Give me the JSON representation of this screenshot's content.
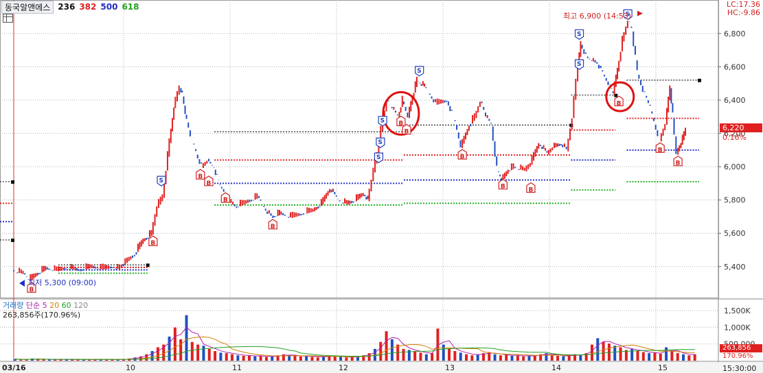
{
  "header": {
    "stock_name": "동국알앤에스",
    "periods": [
      "236",
      "382",
      "500",
      "618"
    ]
  },
  "top_right": {
    "lc": "LC:17.36",
    "hc": "HC:-9.86"
  },
  "labels": {
    "high": "최고 6,900 (14:53)",
    "low": "최저 5,300 (09:00)",
    "current_price": "6,220",
    "current_pct": "0.16%",
    "volume_value": "263,856",
    "volume_pct": "170.96%",
    "time": "15:30:00"
  },
  "volume_legend": {
    "title": "거래량",
    "ma_label": "단순 5",
    "p20": "20",
    "p60": "60",
    "p120": "120",
    "value_line": "263,856주(170.96%)"
  },
  "colors": {
    "up": "#e02020",
    "down": "#2050c0",
    "grid": "#b0b0b0",
    "ma5": "#b020b0",
    "ma20": "#d08000",
    "ma60": "#20a020",
    "fib_red": "#e02020",
    "fib_blue": "#2030c0",
    "fib_green": "#20b020",
    "fib_black": "#222222"
  },
  "chart_data": {
    "type": "line",
    "price_axis": {
      "min": 5300,
      "max": 6900,
      "ticks": [
        5400,
        5600,
        5800,
        6000,
        6200,
        6400,
        6600,
        6800
      ],
      "tick_labels": [
        "5,400",
        "5,600",
        "5,800",
        "6,000",
        "6,200",
        "6,400",
        "6,600",
        "6,800"
      ]
    },
    "volume_axis": {
      "ticks": [
        1500000,
        1000000,
        500000
      ],
      "tick_labels": [
        "1,500K",
        "1,000K",
        "500,000"
      ]
    },
    "x_labels": [
      "03/16",
      "10",
      "11",
      "12",
      "13",
      "14",
      "15"
    ],
    "price_path": [
      {
        "t": 0.0,
        "p": 5380
      },
      {
        "t": 0.2,
        "p": 5360
      },
      {
        "t": 0.3,
        "p": 5320
      },
      {
        "t": 0.45,
        "p": 5360
      },
      {
        "t": 0.6,
        "p": 5390
      },
      {
        "t": 0.8,
        "p": 5380
      },
      {
        "t": 1.0,
        "p": 5395
      },
      {
        "t": 1.2,
        "p": 5380
      },
      {
        "t": 1.4,
        "p": 5400
      },
      {
        "t": 1.6,
        "p": 5390
      },
      {
        "t": 1.8,
        "p": 5400
      },
      {
        "t": 1.9,
        "p": 5390
      },
      {
        "t": 2.0,
        "p": 5420
      },
      {
        "t": 2.2,
        "p": 5480
      },
      {
        "t": 2.35,
        "p": 5560
      },
      {
        "t": 2.5,
        "p": 5600
      },
      {
        "t": 2.6,
        "p": 5760
      },
      {
        "t": 2.7,
        "p": 5820
      },
      {
        "t": 2.82,
        "p": 6150
      },
      {
        "t": 2.9,
        "p": 6360
      },
      {
        "t": 3.0,
        "p": 6480
      },
      {
        "t": 3.05,
        "p": 6430
      },
      {
        "t": 3.1,
        "p": 6320
      },
      {
        "t": 3.2,
        "p": 6180
      },
      {
        "t": 3.3,
        "p": 6080
      },
      {
        "t": 3.4,
        "p": 6000
      },
      {
        "t": 3.5,
        "p": 6040
      },
      {
        "t": 3.62,
        "p": 5990
      },
      {
        "t": 3.7,
        "p": 5900
      },
      {
        "t": 3.8,
        "p": 5860
      },
      {
        "t": 3.9,
        "p": 5790
      },
      {
        "t": 4.0,
        "p": 5760
      },
      {
        "t": 4.2,
        "p": 5790
      },
      {
        "t": 4.4,
        "p": 5820
      },
      {
        "t": 4.55,
        "p": 5740
      },
      {
        "t": 4.65,
        "p": 5700
      },
      {
        "t": 4.8,
        "p": 5720
      },
      {
        "t": 5.0,
        "p": 5700
      },
      {
        "t": 5.2,
        "p": 5720
      },
      {
        "t": 5.4,
        "p": 5740
      },
      {
        "t": 5.55,
        "p": 5780
      },
      {
        "t": 5.7,
        "p": 5870
      },
      {
        "t": 5.85,
        "p": 5800
      },
      {
        "t": 6.0,
        "p": 5780
      },
      {
        "t": 6.15,
        "p": 5800
      },
      {
        "t": 6.3,
        "p": 5840
      },
      {
        "t": 6.38,
        "p": 5800
      },
      {
        "t": 6.45,
        "p": 5920
      },
      {
        "t": 6.55,
        "p": 6080
      },
      {
        "t": 6.62,
        "p": 6220
      },
      {
        "t": 6.72,
        "p": 6400
      },
      {
        "t": 6.82,
        "p": 6350
      },
      {
        "t": 6.92,
        "p": 6300
      },
      {
        "t": 7.0,
        "p": 6400
      },
      {
        "t": 7.1,
        "p": 6300
      },
      {
        "t": 7.18,
        "p": 6420
      },
      {
        "t": 7.26,
        "p": 6520
      },
      {
        "t": 7.4,
        "p": 6480
      },
      {
        "t": 7.6,
        "p": 6380
      },
      {
        "t": 7.8,
        "p": 6400
      },
      {
        "t": 7.95,
        "p": 6260
      },
      {
        "t": 8.05,
        "p": 6120
      },
      {
        "t": 8.2,
        "p": 6250
      },
      {
        "t": 8.3,
        "p": 6300
      },
      {
        "t": 8.4,
        "p": 6400
      },
      {
        "t": 8.5,
        "p": 6300
      },
      {
        "t": 8.6,
        "p": 6250
      },
      {
        "t": 8.7,
        "p": 5980
      },
      {
        "t": 8.78,
        "p": 5920
      },
      {
        "t": 8.9,
        "p": 5980
      },
      {
        "t": 9.0,
        "p": 6000
      },
      {
        "t": 9.2,
        "p": 5980
      },
      {
        "t": 9.3,
        "p": 6020
      },
      {
        "t": 9.45,
        "p": 6140
      },
      {
        "t": 9.6,
        "p": 6080
      },
      {
        "t": 9.7,
        "p": 6120
      },
      {
        "t": 9.85,
        "p": 6140
      },
      {
        "t": 9.95,
        "p": 6100
      },
      {
        "t": 10.05,
        "p": 6300
      },
      {
        "t": 10.12,
        "p": 6520
      },
      {
        "t": 10.2,
        "p": 6740
      },
      {
        "t": 10.3,
        "p": 6660
      },
      {
        "t": 10.4,
        "p": 6640
      },
      {
        "t": 10.5,
        "p": 6620
      },
      {
        "t": 10.6,
        "p": 6560
      },
      {
        "t": 10.7,
        "p": 6500
      },
      {
        "t": 10.78,
        "p": 6440
      },
      {
        "t": 10.86,
        "p": 6580
      },
      {
        "t": 10.95,
        "p": 6760
      },
      {
        "t": 11.05,
        "p": 6880
      },
      {
        "t": 11.12,
        "p": 6820
      },
      {
        "t": 11.22,
        "p": 6560
      },
      {
        "t": 11.32,
        "p": 6460
      },
      {
        "t": 11.42,
        "p": 6380
      },
      {
        "t": 11.52,
        "p": 6260
      },
      {
        "t": 11.62,
        "p": 6160
      },
      {
        "t": 11.72,
        "p": 6260
      },
      {
        "t": 11.8,
        "p": 6480
      },
      {
        "t": 11.85,
        "p": 6300
      },
      {
        "t": 11.92,
        "p": 6080
      },
      {
        "t": 12.0,
        "p": 6140
      },
      {
        "t": 12.08,
        "p": 6220
      }
    ],
    "markers": [
      {
        "type": "B",
        "t": 0.32,
        "p": 5320
      },
      {
        "type": "B",
        "t": 2.5,
        "p": 5600
      },
      {
        "type": "S",
        "t": 2.65,
        "p": 5860
      },
      {
        "type": "B",
        "t": 3.35,
        "p": 6000
      },
      {
        "type": "B",
        "t": 3.5,
        "p": 5960
      },
      {
        "type": "B",
        "t": 3.8,
        "p": 5860
      },
      {
        "type": "B",
        "t": 4.65,
        "p": 5700
      },
      {
        "type": "S",
        "t": 6.55,
        "p": 6000
      },
      {
        "type": "S",
        "t": 6.58,
        "p": 6090
      },
      {
        "type": "S",
        "t": 6.62,
        "p": 6220
      },
      {
        "type": "B",
        "t": 6.95,
        "p": 6320
      },
      {
        "type": "B",
        "t": 7.05,
        "p": 6270
      },
      {
        "type": "S",
        "t": 7.28,
        "p": 6520
      },
      {
        "type": "B",
        "t": 8.05,
        "p": 6120
      },
      {
        "type": "B",
        "t": 8.78,
        "p": 5940
      },
      {
        "type": "B",
        "t": 9.28,
        "p": 5920
      },
      {
        "type": "S",
        "t": 10.15,
        "p": 6560
      },
      {
        "type": "S",
        "t": 10.15,
        "p": 6740
      },
      {
        "type": "B",
        "t": 10.86,
        "p": 6440
      },
      {
        "type": "S",
        "t": 11.02,
        "p": 6860
      },
      {
        "type": "B",
        "t": 11.6,
        "p": 6160
      },
      {
        "type": "B",
        "t": 11.92,
        "p": 6080
      }
    ],
    "circles": [
      {
        "t": 6.95,
        "p": 6320
      },
      {
        "t": 10.88,
        "p": 6420
      }
    ],
    "levels": [
      {
        "color": "black",
        "from": 0.0,
        "to": 0.0,
        "p": 5910
      },
      {
        "color": "red",
        "from": 0.0,
        "to": 0.0,
        "p": 5780
      },
      {
        "color": "blue",
        "from": 0.0,
        "to": 0.0,
        "p": 5670
      },
      {
        "color": "black",
        "from": 0.0,
        "to": 0.0,
        "p": 5560
      },
      {
        "color": "black",
        "from": 0.8,
        "to": 2.4,
        "p": 5410
      },
      {
        "color": "red",
        "from": 0.8,
        "to": 2.4,
        "p": 5395
      },
      {
        "color": "blue",
        "from": 0.8,
        "to": 2.4,
        "p": 5380
      },
      {
        "color": "green",
        "from": 0.8,
        "to": 2.4,
        "p": 5360
      },
      {
        "color": "black",
        "from": 3.6,
        "to": 7.0,
        "p": 6210
      },
      {
        "color": "red",
        "from": 3.6,
        "to": 7.0,
        "p": 6040
      },
      {
        "color": "blue",
        "from": 3.6,
        "to": 7.0,
        "p": 5900
      },
      {
        "color": "green",
        "from": 3.6,
        "to": 7.0,
        "p": 5770
      },
      {
        "color": "black",
        "from": 7.0,
        "to": 10.0,
        "p": 6250
      },
      {
        "color": "red",
        "from": 7.0,
        "to": 10.0,
        "p": 6070
      },
      {
        "color": "blue",
        "from": 7.0,
        "to": 10.0,
        "p": 5920
      },
      {
        "color": "green",
        "from": 7.0,
        "to": 10.0,
        "p": 5780
      },
      {
        "color": "black",
        "from": 10.0,
        "to": 10.8,
        "p": 6430
      },
      {
        "color": "red",
        "from": 10.0,
        "to": 10.8,
        "p": 6220
      },
      {
        "color": "blue",
        "from": 10.0,
        "to": 10.8,
        "p": 6040
      },
      {
        "color": "green",
        "from": 10.0,
        "to": 10.8,
        "p": 5860
      },
      {
        "color": "black",
        "from": 11.0,
        "to": 12.3,
        "p": 6520
      },
      {
        "color": "red",
        "from": 11.0,
        "to": 12.3,
        "p": 6290
      },
      {
        "color": "blue",
        "from": 11.0,
        "to": 12.3,
        "p": 6100
      },
      {
        "color": "green",
        "from": 11.0,
        "to": 12.3,
        "p": 5910
      }
    ],
    "volume_bars": [
      0.03,
      0.02,
      0.02,
      0.04,
      0.03,
      0.02,
      0.02,
      0.03,
      0.02,
      0.02,
      0.02,
      0.03,
      0.02,
      0.02,
      0.02,
      0.03,
      0.02,
      0.02,
      0.02,
      0.03,
      0.04,
      0.06,
      0.08,
      0.12,
      0.18,
      0.25,
      0.3,
      0.45,
      0.62,
      0.4,
      0.85,
      0.35,
      0.3,
      0.28,
      0.22,
      0.18,
      0.15,
      0.14,
      0.12,
      0.1,
      0.09,
      0.1,
      0.08,
      0.09,
      0.07,
      0.08,
      0.1,
      0.12,
      0.1,
      0.09,
      0.08,
      0.09,
      0.07,
      0.06,
      0.08,
      0.09,
      0.08,
      0.07,
      0.06,
      0.07,
      0.08,
      0.1,
      0.14,
      0.22,
      0.35,
      0.55,
      0.4,
      0.3,
      0.22,
      0.2,
      0.18,
      0.15,
      0.12,
      0.14,
      0.6,
      0.3,
      0.22,
      0.18,
      0.15,
      0.12,
      0.1,
      0.12,
      0.14,
      0.16,
      0.12,
      0.1,
      0.11,
      0.09,
      0.1,
      0.08,
      0.09,
      0.1,
      0.12,
      0.14,
      0.1,
      0.09,
      0.08,
      0.1,
      0.12,
      0.1,
      0.14,
      0.3,
      0.42,
      0.35,
      0.32,
      0.28,
      0.25,
      0.2,
      0.22,
      0.18,
      0.16,
      0.14,
      0.15,
      0.13,
      0.25,
      0.18,
      0.14,
      0.12,
      0.1,
      0.12
    ]
  }
}
